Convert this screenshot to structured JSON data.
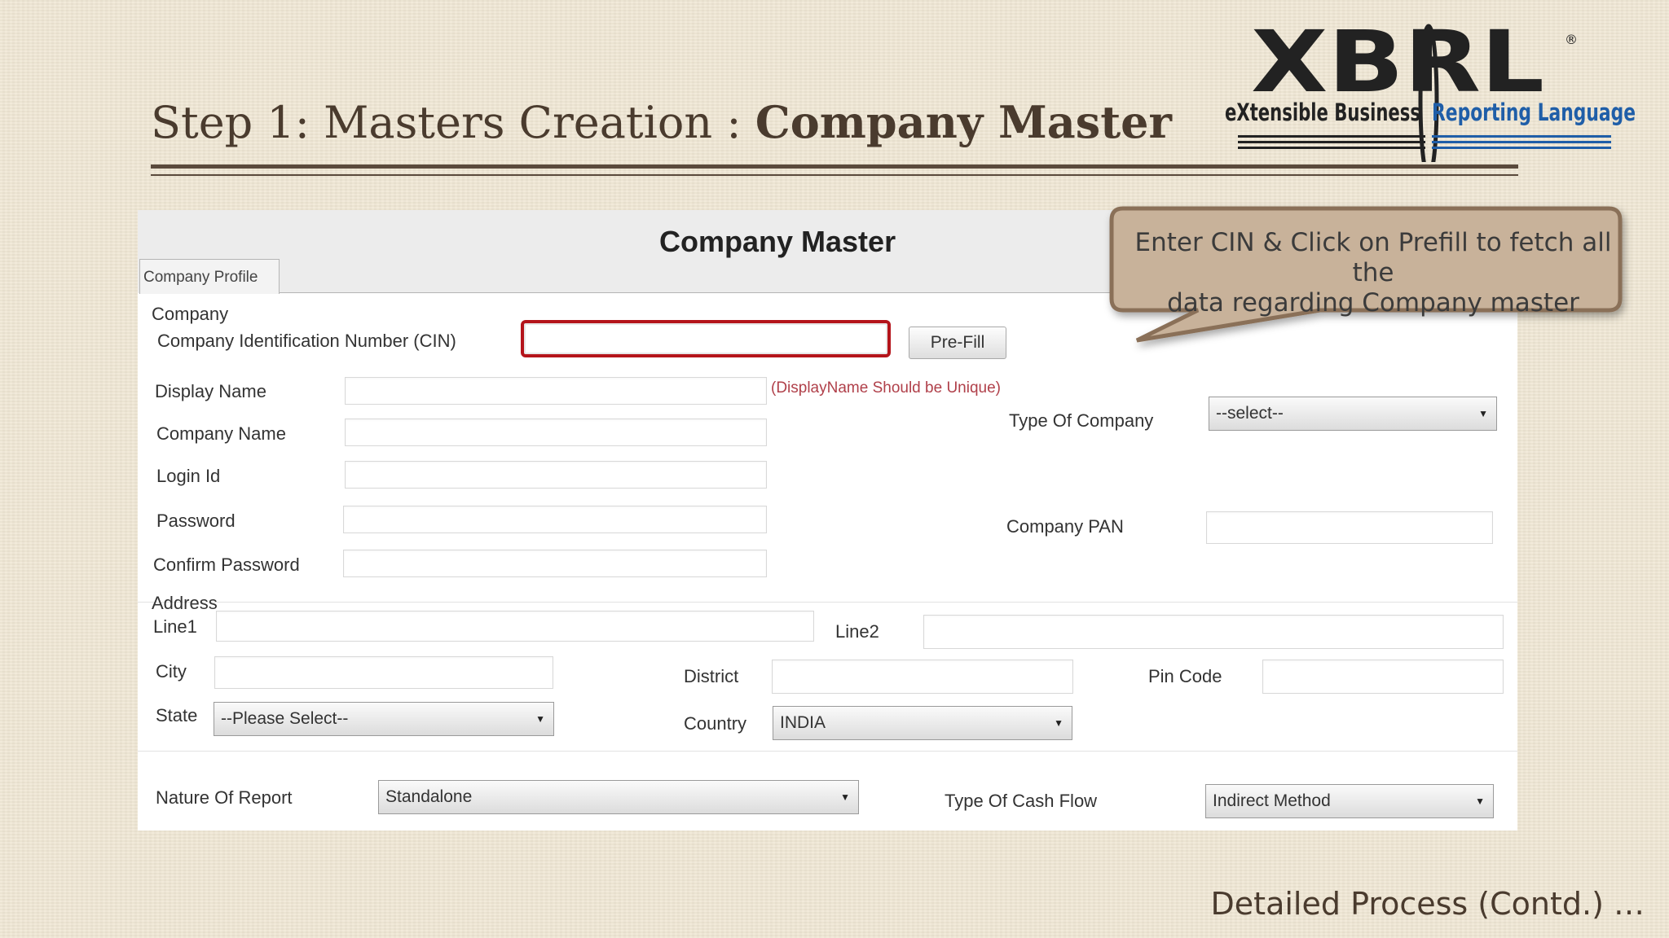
{
  "slide": {
    "title_prefix": "Step 1: Masters Creation : ",
    "title_bold": "Company Master",
    "footer": "Detailed Process (Contd.) …",
    "logo": {
      "wordmark": "XBRL",
      "registered": "®",
      "tagline_left": "eXtensible Business ",
      "tagline_right": "Reporting Language"
    },
    "callout": {
      "line1": "Enter CIN & Click on Prefill to fetch all the",
      "line2": "data regarding Company master"
    }
  },
  "form": {
    "title": "Company Master",
    "tab": "Company Profile",
    "company_group": "Company",
    "cin_label": "Company Identification Number (CIN)",
    "cin_value": "",
    "prefill_label": "Pre-Fill",
    "display_name_label": "Display Name",
    "display_name_note": "(DisplayName Should be Unique)",
    "company_name_label": "Company Name",
    "login_id_label": "Login Id",
    "password_label": "Password",
    "confirm_password_label": "Confirm Password",
    "type_of_company_label": "Type Of Company",
    "type_of_company_value": "--select--",
    "company_pan_label": "Company PAN",
    "address_group": "Address",
    "line1_label": "Line1",
    "line2_label": "Line2",
    "city_label": "City",
    "district_label": "District",
    "pin_code_label": "Pin Code",
    "state_label": "State",
    "state_value": "--Please Select--",
    "country_label": "Country",
    "country_value": "INDIA",
    "nature_of_report_label": "Nature Of Report",
    "nature_of_report_value": "Standalone",
    "type_of_cash_flow_label": "Type Of Cash Flow",
    "type_of_cash_flow_value": "Indirect Method"
  },
  "colors": {
    "background": "#efe6d3",
    "title_text": "#4a3b2e",
    "cin_highlight": "#b4141b",
    "callout_fill": "#c8b29a",
    "callout_border": "#8a7058",
    "logo_black": "#222222",
    "logo_blue": "#1f5ea8"
  }
}
